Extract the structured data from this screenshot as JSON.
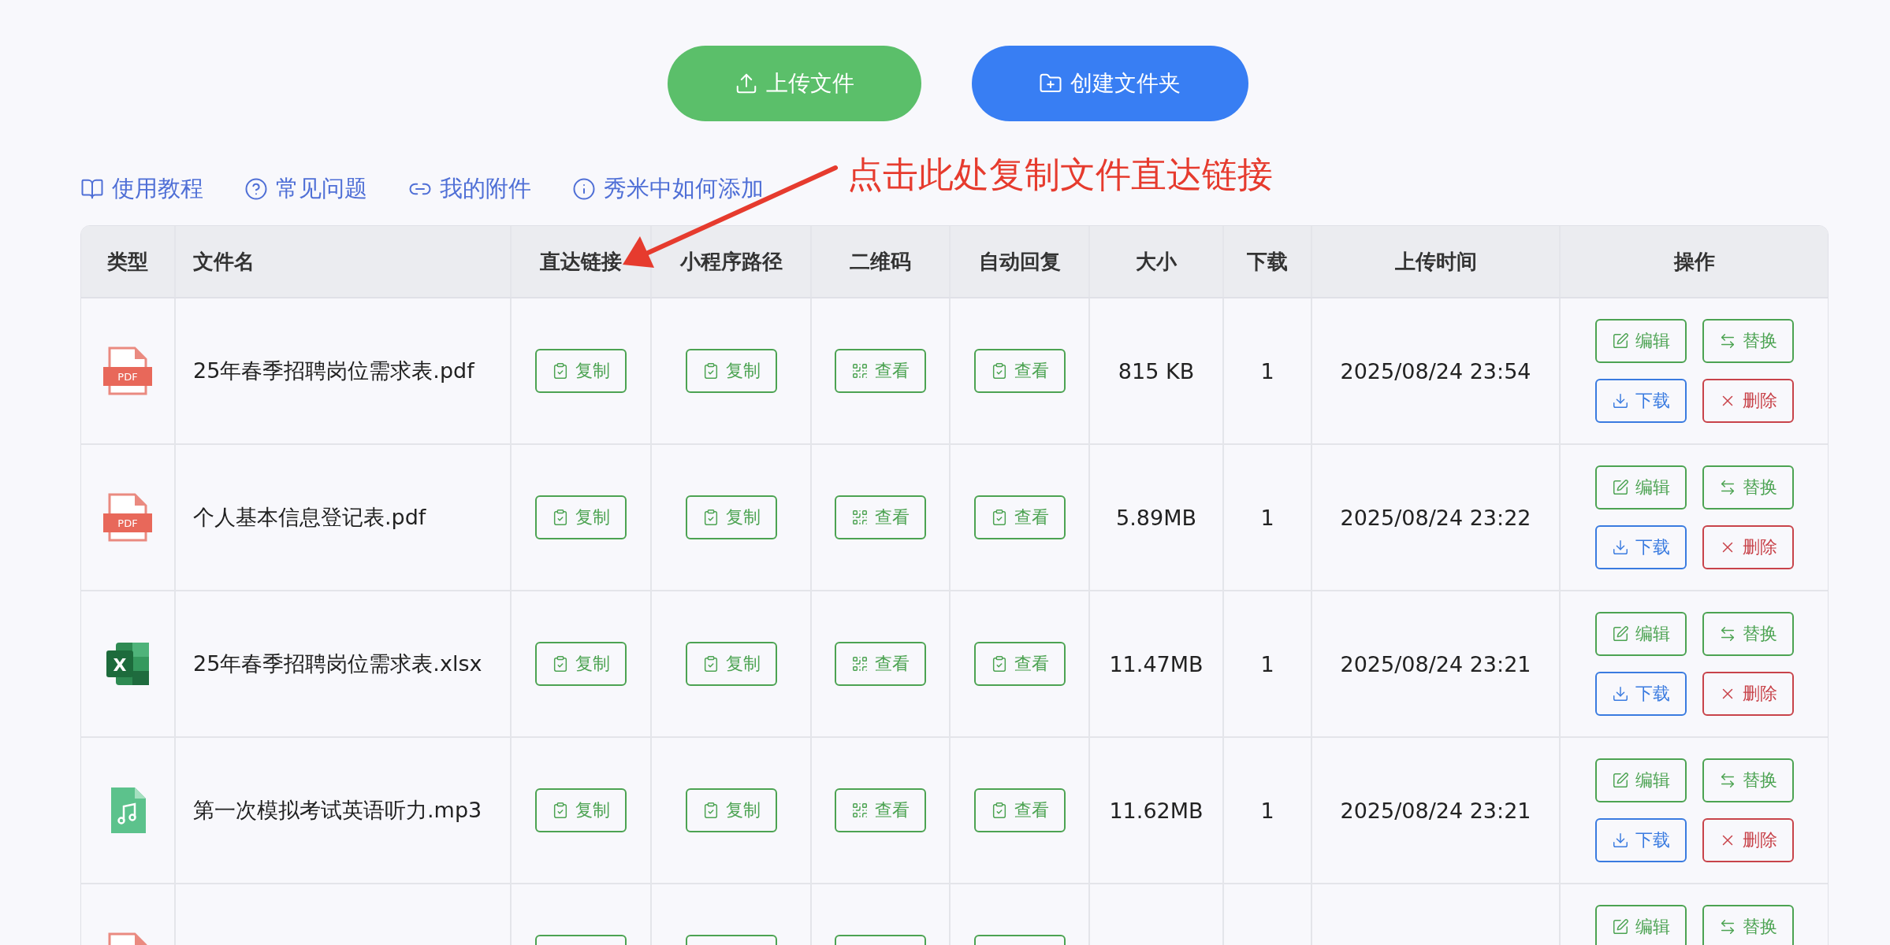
{
  "toolbar": {
    "buttons": [
      {
        "kind": "upload",
        "label": "上传文件"
      },
      {
        "kind": "create_folder",
        "label": "创建文件夹"
      }
    ]
  },
  "help_links": [
    {
      "kind": "guide",
      "label": "使用教程"
    },
    {
      "kind": "faq",
      "label": "常见问题"
    },
    {
      "kind": "attachments",
      "label": "我的附件"
    },
    {
      "kind": "info",
      "label": "秀米中如何添加"
    }
  ],
  "annotation": {
    "text": "点击此处复制文件直达链接"
  },
  "table": {
    "columns": [
      "类型",
      "文件名",
      "直达链接",
      "小程序路径",
      "二维码",
      "自动回复",
      "大小",
      "下载",
      "上传时间",
      "操作"
    ],
    "rows": [
      {
        "kind": "pdf",
        "icon_label": "PDF",
        "name": "25年春季招聘岗位需求表.pdf",
        "direct_link": "复制",
        "mini_program_path": "复制",
        "qr_code": "查看",
        "auto_reply": "查看",
        "size": "815 KB",
        "downloads": "1",
        "uploaded": "2025/08/24 23:54",
        "actions": [
          {
            "kind": "edit",
            "label": "编辑"
          },
          {
            "kind": "replace",
            "label": "替换"
          },
          {
            "kind": "download",
            "label": "下载"
          },
          {
            "kind": "delete",
            "label": "删除"
          }
        ]
      },
      {
        "kind": "pdf",
        "icon_label": "PDF",
        "name": "个人基本信息登记表.pdf",
        "direct_link": "复制",
        "mini_program_path": "复制",
        "qr_code": "查看",
        "auto_reply": "查看",
        "size": "5.89MB",
        "downloads": "1",
        "uploaded": "2025/08/24 23:22",
        "actions": [
          {
            "kind": "edit",
            "label": "编辑"
          },
          {
            "kind": "replace",
            "label": "替换"
          },
          {
            "kind": "download",
            "label": "下载"
          },
          {
            "kind": "delete",
            "label": "删除"
          }
        ]
      },
      {
        "kind": "xlsx",
        "icon_label": "X",
        "name": "25年春季招聘岗位需求表.xlsx",
        "direct_link": "复制",
        "mini_program_path": "复制",
        "qr_code": "查看",
        "auto_reply": "查看",
        "size": "11.47MB",
        "downloads": "1",
        "uploaded": "2025/08/24 23:21",
        "actions": [
          {
            "kind": "edit",
            "label": "编辑"
          },
          {
            "kind": "replace",
            "label": "替换"
          },
          {
            "kind": "download",
            "label": "下载"
          },
          {
            "kind": "delete",
            "label": "删除"
          }
        ]
      },
      {
        "kind": "mp3",
        "name": "第一次模拟考试英语听力.mp3",
        "direct_link": "复制",
        "mini_program_path": "复制",
        "qr_code": "查看",
        "auto_reply": "查看",
        "size": "11.62MB",
        "downloads": "1",
        "uploaded": "2025/08/24 23:21",
        "actions": [
          {
            "kind": "edit",
            "label": "编辑"
          },
          {
            "kind": "replace",
            "label": "替换"
          },
          {
            "kind": "download",
            "label": "下载"
          },
          {
            "kind": "delete",
            "label": "删除"
          }
        ]
      },
      {
        "kind": "pdf",
        "cut_off": true,
        "actions": [
          {
            "kind": "edit",
            "label": "编辑"
          },
          {
            "kind": "replace",
            "label": "替换"
          }
        ]
      }
    ]
  }
}
